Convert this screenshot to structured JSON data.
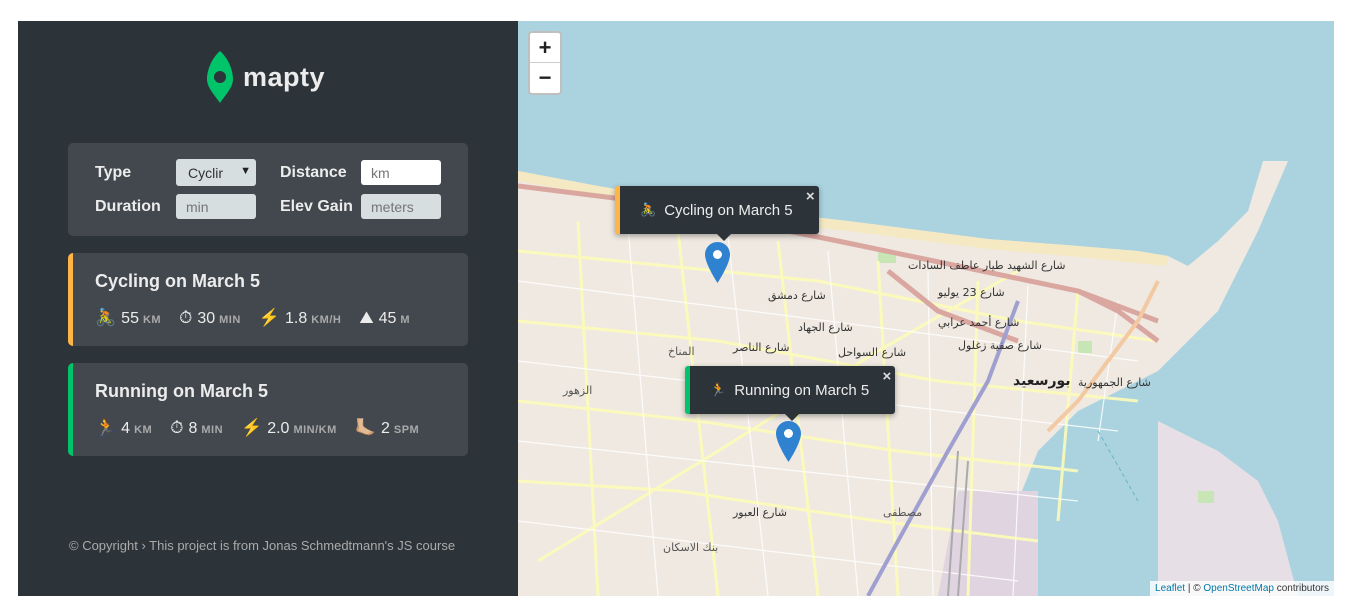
{
  "logo": {
    "text": "mapty",
    "icon": "map-pin-icon",
    "color": "#00c46a"
  },
  "form": {
    "type_label": "Type",
    "type_value": "Cyclir",
    "distance_label": "Distance",
    "distance_placeholder": "km",
    "duration_label": "Duration",
    "duration_placeholder": "min",
    "elev_label": "Elev Gain",
    "elev_placeholder": "meters"
  },
  "workouts": [
    {
      "type": "cycling",
      "title": "Cycling on March 5",
      "color": "#ffb545",
      "details": [
        {
          "icon": "🚴",
          "value": "55",
          "unit": "km"
        },
        {
          "icon": "⏱",
          "value": "30",
          "unit": "min"
        },
        {
          "icon": "⚡️",
          "value": "1.8",
          "unit": "km/h"
        },
        {
          "icon": "⛰",
          "value": "45",
          "unit": "m"
        }
      ]
    },
    {
      "type": "running",
      "title": "Running on March 5",
      "color": "#00c46a",
      "details": [
        {
          "icon": "🏃",
          "value": "4",
          "unit": "km"
        },
        {
          "icon": "⏱",
          "value": "8",
          "unit": "min"
        },
        {
          "icon": "⚡️",
          "value": "2.0",
          "unit": "min/km"
        },
        {
          "icon": "🦶🏼",
          "value": "2",
          "unit": "spm"
        }
      ]
    }
  ],
  "copyright": "© Copyright › This project is from Jonas Schmedtmann's JS course",
  "map": {
    "zoom_in": "+",
    "zoom_out": "−",
    "popups": [
      {
        "icon": "🚴",
        "text": "Cycling on March 5",
        "close": "×"
      },
      {
        "icon": "🏃",
        "text": "Running on March 5",
        "close": "×"
      }
    ],
    "labels": {
      "city": "بورسعيد",
      "street1": "شارع الشهيد طيار عاطف السادات",
      "street2": "شارع 23 يوليو",
      "street3": "شارع دمشق",
      "street4": "شارع الجهاد",
      "street5": "شارع الناصر",
      "street6": "المناخ",
      "street7": "الزهور",
      "street8": "شارع العبور",
      "street9": "بنك الاسكان",
      "street10": "مصطفى",
      "street11": "شارع أحمد عرابي",
      "street12": "شارع صفية زغلول",
      "street13": "شارع الجمهورية",
      "street14": "شارع السواحل"
    },
    "attribution": {
      "leaflet": "Leaflet",
      "sep": " | © ",
      "osm": "OpenStreetMap",
      "contrib": " contributors"
    }
  }
}
